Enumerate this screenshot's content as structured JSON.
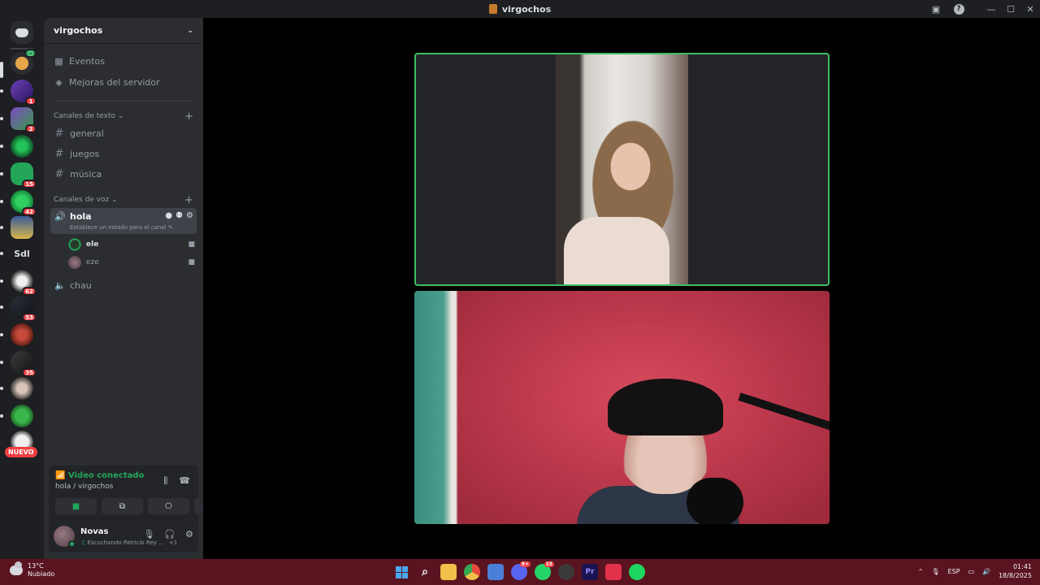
{
  "window": {
    "title": "virgochos",
    "inbox_icon": "inbox-icon",
    "help_label": "?",
    "min_label": "—",
    "max_label": "☐",
    "close_label": "✕"
  },
  "rail": {
    "servers": [
      {
        "badge": ""
      },
      {
        "badge": "1"
      },
      {
        "badge": "2"
      },
      {
        "badge": ""
      },
      {
        "badge": "15"
      },
      {
        "badge": "42"
      },
      {
        "badge": ""
      },
      {
        "text": "Sdl"
      },
      {
        "badge": "62"
      },
      {
        "badge": "53"
      },
      {
        "badge": ""
      },
      {
        "badge": "35"
      },
      {
        "badge": ""
      },
      {
        "badge": ""
      }
    ],
    "new_label": "NUEVO"
  },
  "sidebar": {
    "server_name": "virgochos",
    "events_label": "Eventos",
    "boosts_label": "Mejoras del servidor",
    "text_category": "Canales de texto",
    "text_channels": [
      "general",
      "juegos",
      "música"
    ],
    "voice_category": "Canales de voz",
    "active_voice": {
      "name": "hola",
      "status_placeholder": "Establece un estado para el canal"
    },
    "members": [
      {
        "name": "ele"
      },
      {
        "name": "eze"
      }
    ],
    "other_voice": "chau"
  },
  "voice_panel": {
    "status": "Video conectado",
    "channel_path": "hola / virgochos"
  },
  "user": {
    "name": "Novas",
    "activity": "Escuchando Patricio Rey ...",
    "extra": "+1"
  },
  "taskbar": {
    "temp": "13°C",
    "condition": "Nubiado",
    "apps": [
      {
        "name": "windows-start",
        "label": "",
        "color": "#3a8ee6"
      },
      {
        "name": "search",
        "label": "⌕",
        "color": "transparent"
      },
      {
        "name": "file-explorer",
        "label": "",
        "color": "#f0c04a"
      },
      {
        "name": "chrome",
        "label": "",
        "color": "#e94a3a"
      },
      {
        "name": "store",
        "label": "",
        "color": "#4a7fd8"
      },
      {
        "name": "discord",
        "label": "",
        "color": "#5865f2",
        "badge": "9+"
      },
      {
        "name": "whatsapp",
        "label": "",
        "color": "#25d366",
        "badge": "15"
      },
      {
        "name": "obs",
        "label": "",
        "color": "#3a3a3a"
      },
      {
        "name": "premiere",
        "label": "Pr",
        "color": "#1b1452"
      },
      {
        "name": "tiktok",
        "label": "",
        "color": "#e2314b"
      },
      {
        "name": "spotify",
        "label": "",
        "color": "#1ed760"
      }
    ],
    "lang": "ESP",
    "time": "01:41",
    "date": "18/8/2025"
  }
}
